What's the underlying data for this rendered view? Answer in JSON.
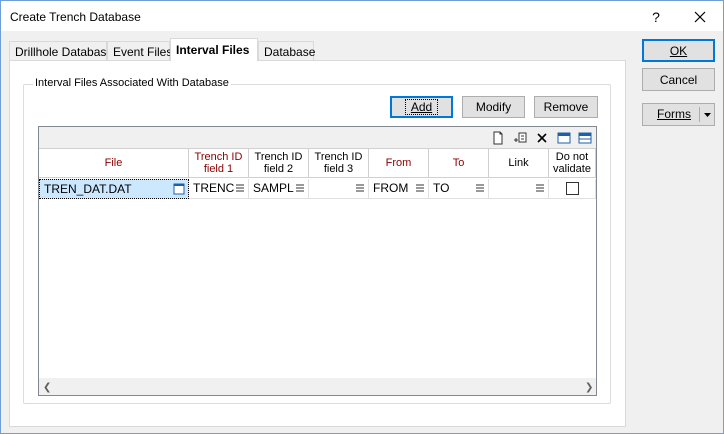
{
  "window": {
    "title": "Create Trench Database",
    "help_glyph": "?"
  },
  "tabs": [
    {
      "label": "Drillhole Database",
      "active": false
    },
    {
      "label": "Event Files",
      "active": false
    },
    {
      "label": "Interval Files",
      "active": true
    },
    {
      "label": "Database",
      "active": false
    }
  ],
  "group": {
    "label": "Interval Files Associated With Database"
  },
  "grid_buttons": {
    "add": "Add",
    "modify": "Modify",
    "remove": "Remove"
  },
  "columns": [
    {
      "label": "File",
      "required": true
    },
    {
      "label": "Trench ID field 1",
      "required": true
    },
    {
      "label": "Trench ID field 2",
      "required": false
    },
    {
      "label": "Trench ID field 3",
      "required": false
    },
    {
      "label": "From",
      "required": true
    },
    {
      "label": "To",
      "required": true
    },
    {
      "label": "Link",
      "required": false
    },
    {
      "label": "Do not validate",
      "required": false
    }
  ],
  "rows": [
    {
      "file": "TREN_DAT.DAT",
      "trench1": "TRENC",
      "trench2": "SAMPL",
      "trench3": "",
      "from": "FROM",
      "to": "TO",
      "link": "",
      "validate_checked": false
    }
  ],
  "side_buttons": {
    "ok": "OK",
    "cancel": "Cancel",
    "forms": "Forms"
  },
  "colors": {
    "accent": "#0078d7",
    "required_header": "#8b0000",
    "selection": "#cce8ff"
  }
}
